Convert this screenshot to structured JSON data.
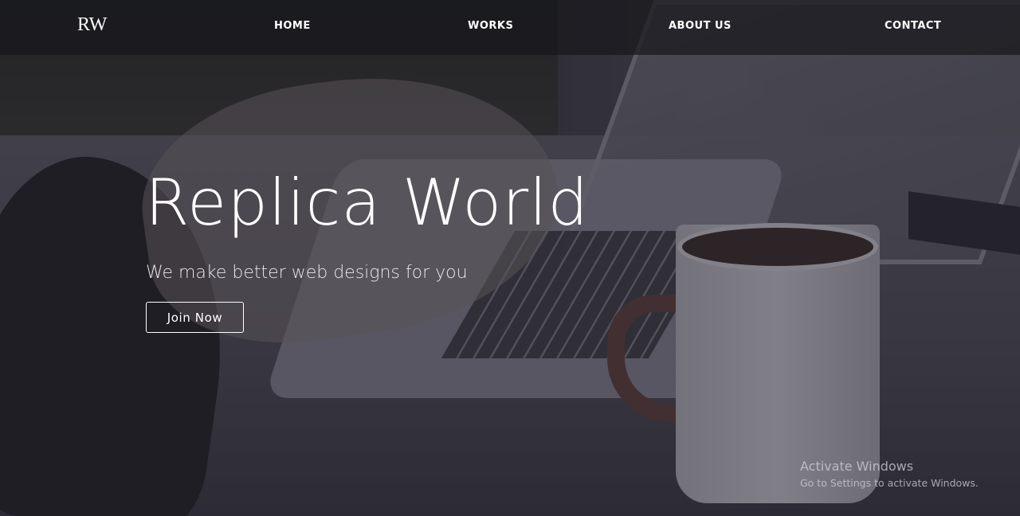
{
  "navbar": {
    "logo": "RW",
    "links": [
      {
        "label": "HOME"
      },
      {
        "label": "WORKS"
      },
      {
        "label": "ABOUT US"
      },
      {
        "label": "CONTACT"
      }
    ]
  },
  "hero": {
    "title": "Replica World",
    "subtitle": "We make better web designs for you",
    "cta_label": "Join Now",
    "background_image": "hands typing on laptop with coffee mug"
  },
  "watermark": {
    "title": "Activate Windows",
    "subtitle": "Go to Settings to activate Windows."
  },
  "colors": {
    "navbar_bg": "#18181c",
    "text": "#ffffff",
    "overlay": "#14121e"
  }
}
